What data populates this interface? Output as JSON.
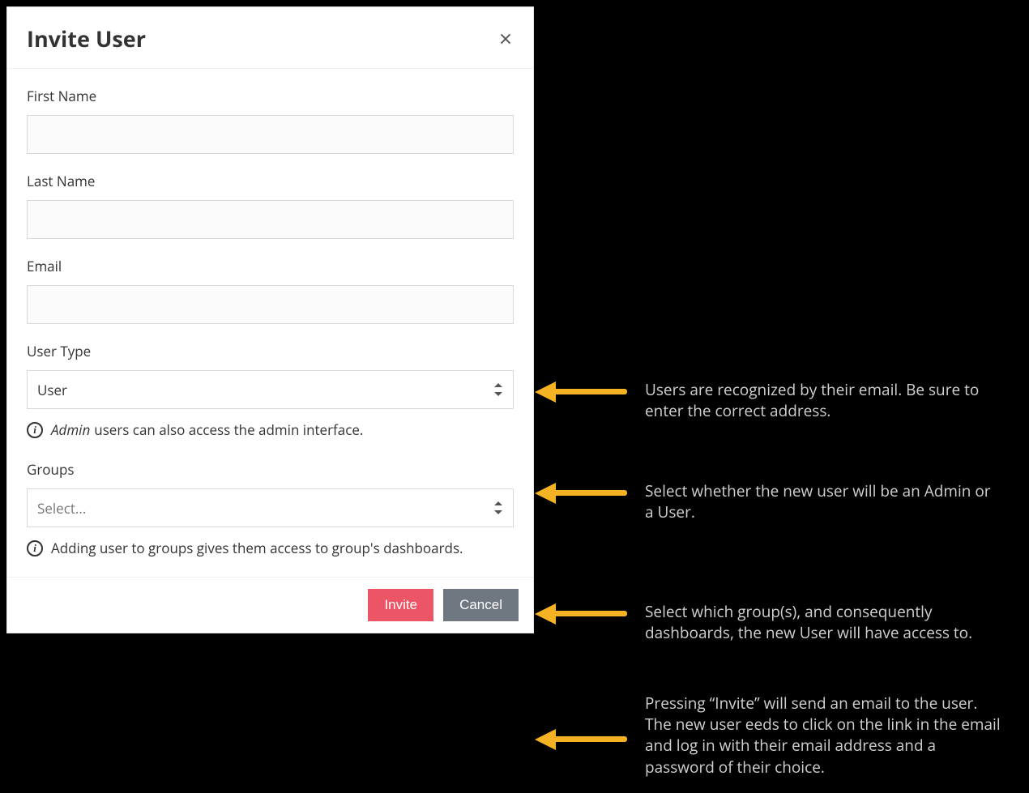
{
  "modal": {
    "title": "Invite User",
    "fields": {
      "first_name": {
        "label": "First Name",
        "value": ""
      },
      "last_name": {
        "label": "Last Name",
        "value": ""
      },
      "email": {
        "label": "Email",
        "value": ""
      },
      "user_type": {
        "label": "User Type",
        "selected": "User"
      },
      "groups": {
        "label": "Groups",
        "placeholder": "Select..."
      }
    },
    "info": {
      "admin_prefix": "Admin",
      "admin_rest": "users can also access the admin interface.",
      "groups": "Adding user to groups gives them access to group's dashboards."
    },
    "buttons": {
      "invite": "Invite",
      "cancel": "Cancel"
    }
  },
  "annotations": {
    "email": "Users are recognized by their email. Be sure to enter the correct address.",
    "user_type": "Select whether the new user will be an Admin or a User.",
    "groups": "Select which group(s), and consequently dashboards, the new User will have access to.",
    "invite": "Pressing “Invite” will send an email to the user. The new user eeds to click on the link in the email and log in with their email address and a password of their choice."
  }
}
